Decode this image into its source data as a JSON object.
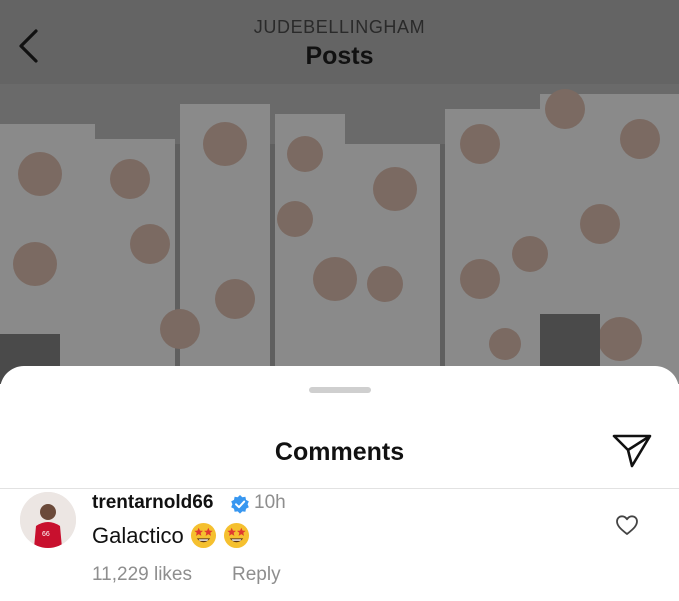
{
  "header": {
    "username": "JUDEBELLINGHAM",
    "title": "Posts",
    "back_icon": "chevron-left-icon"
  },
  "post": {
    "image_description_icon": "crowd-photo"
  },
  "comments_sheet": {
    "title": "Comments",
    "share_icon": "paper-plane-icon"
  },
  "comments": [
    {
      "username": "trentarnold66",
      "verified": true,
      "time": "10h",
      "text": "Galactico",
      "emojis": [
        "star-struck-emoji",
        "star-struck-emoji"
      ],
      "likes": "11,229 likes",
      "reply_label": "Reply",
      "like_icon": "heart-outline-icon"
    }
  ],
  "colors": {
    "header_bg": "#646464",
    "verified_blue": "#3897f0",
    "muted_text": "#8e8e8e"
  }
}
